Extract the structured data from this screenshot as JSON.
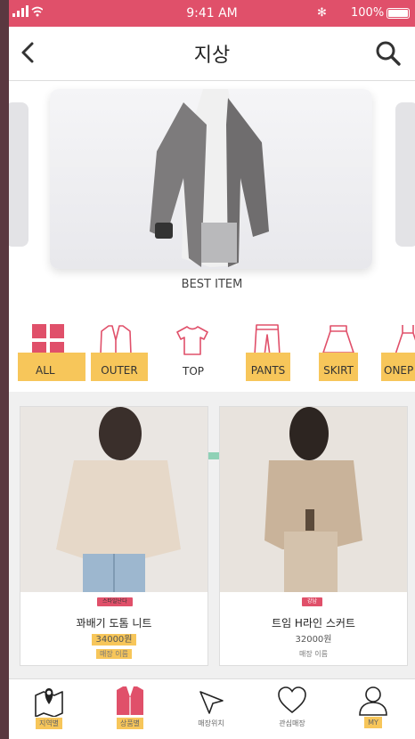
{
  "status_bar": {
    "signal": "▮▮▮ ",
    "time": "9:41 AM",
    "bluetooth": "✻",
    "battery": "100%"
  },
  "header": {
    "title": "지상"
  },
  "banner": {
    "caption": "BEST ITEM"
  },
  "categories": [
    {
      "label": "ALL",
      "icon": "grid-icon"
    },
    {
      "label": "OUTER",
      "icon": "jacket-icon"
    },
    {
      "label": "TOP",
      "icon": "tshirt-icon"
    },
    {
      "label": "PANTS",
      "icon": "pants-icon"
    },
    {
      "label": "SKIRT",
      "icon": "skirt-icon"
    },
    {
      "label": "ONEP",
      "icon": "dress-icon"
    }
  ],
  "products": [
    {
      "badge": "스타일난다",
      "name": "꽈배기 도톰 니트",
      "price": "34000원",
      "store": "매장 이름"
    },
    {
      "badge": "강남",
      "name": "트임 H라인 스커트",
      "price": "32000원",
      "store": "매장 이름"
    }
  ],
  "tabs": [
    {
      "label": "지역별",
      "icon": "map-pin-icon"
    },
    {
      "label": "상품별",
      "icon": "clothing-icon"
    },
    {
      "label": "매장위치",
      "icon": "location-arrow-icon"
    },
    {
      "label": "관심매장",
      "icon": "heart-icon"
    },
    {
      "label": "MY",
      "icon": "user-icon"
    }
  ],
  "colors": {
    "accent": "#e0506a",
    "highlight": "#f7c65a",
    "teal": "#8fd1b6"
  }
}
